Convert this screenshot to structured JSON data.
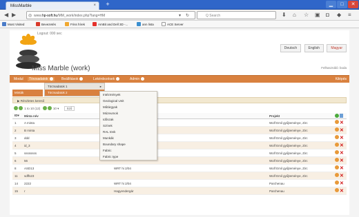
{
  "browser": {
    "tab_title": "MissMarble",
    "tab_close": "×",
    "new_tab": "+",
    "url_prefix": "www.",
    "url_domain": "hp-soft.hu",
    "url_rest": "/MM_work/index.php?lang=HM",
    "search_placeholder": "Q Search",
    "bookmarks": [
      {
        "label": "Most Visited",
        "color": "#4a7bc8"
      },
      {
        "label": "Bevezetés",
        "color": "#d93a2b"
      },
      {
        "label": "Friss hírek",
        "color": "#f0a830"
      },
      {
        "label": "AmBit and Dell 3D -...",
        "color": "#e5312b"
      },
      {
        "label": "ann lista",
        "color": "#3a8fd0"
      },
      {
        "label": "ACE Server",
        "color": "#f5f5f5"
      }
    ]
  },
  "header": {
    "logged_in": "Logout: 000 sec",
    "app_title": "Miss Marble (work)",
    "user_info": "Felhasználó: boda",
    "languages": [
      "Deutsch",
      "English",
      "Magyar"
    ]
  },
  "menu": {
    "items": [
      "Modul",
      "Törzsadatok",
      "Beállítások",
      "Lekérdezések",
      "Admin"
    ],
    "logout": "Kilépés"
  },
  "submenu1": [
    "Törzsadatok 1",
    "Törzsadatok 2"
  ],
  "submenu2": [
    "Intézmények",
    "Geological Unit",
    "Műtárgyak",
    "Múzeumok",
    "Időszak",
    "Színek",
    "RAL tönk",
    "Munkák",
    "Boundary shape",
    "Fabric",
    "Fabric type"
  ],
  "section": "Minták",
  "subheader": "Részletes kereső",
  "pager": {
    "text": "1 to 10 (12)",
    "per_page": "10",
    "placeholder": "Szű"
  },
  "table": {
    "headers": [
      "ID▾",
      "Minta név",
      "",
      "Projekt",
      ""
    ],
    "rows": [
      {
        "id": "1",
        "name": "A minta",
        "extra": "",
        "project": "Wolf Emil gyűjteménye, Zirc"
      },
      {
        "id": "2",
        "name": "B minta",
        "extra": "",
        "project": "Wolf Emil gyűjteménye, Zirc"
      },
      {
        "id": "3",
        "name": "ddd",
        "extra": "",
        "project": "Wolf Emil gyűjteménye, Zirc"
      },
      {
        "id": "4",
        "name": "id_3",
        "extra": "",
        "project": "Wolf Emil gyűjteménye, Zirc"
      },
      {
        "id": "5",
        "name": "ssssssss",
        "extra": "",
        "project": "Wolf Emil gyűjteménye, Zirc"
      },
      {
        "id": "6",
        "name": "56",
        "extra": "",
        "project": "Wolf Emil gyűjteménye, Zirc"
      },
      {
        "id": "8",
        "name": "ASD13",
        "extra": "WRT hi 2/04",
        "project": "Wolf Emil gyűjteménye, Zirc"
      },
      {
        "id": "11",
        "name": "sdffs23",
        "extra": "",
        "project": "Wolf Emil gyűjteménye, Zirc"
      },
      {
        "id": "14",
        "name": "2222",
        "extra": "WRT hi 2/04",
        "project": "Parchenau"
      },
      {
        "id": "15",
        "name": "r",
        "extra": "Hagyendergár",
        "project": "Parchenau"
      }
    ]
  },
  "colors": {
    "accent": "#d9813f",
    "titlebar": "#2f66c9"
  }
}
